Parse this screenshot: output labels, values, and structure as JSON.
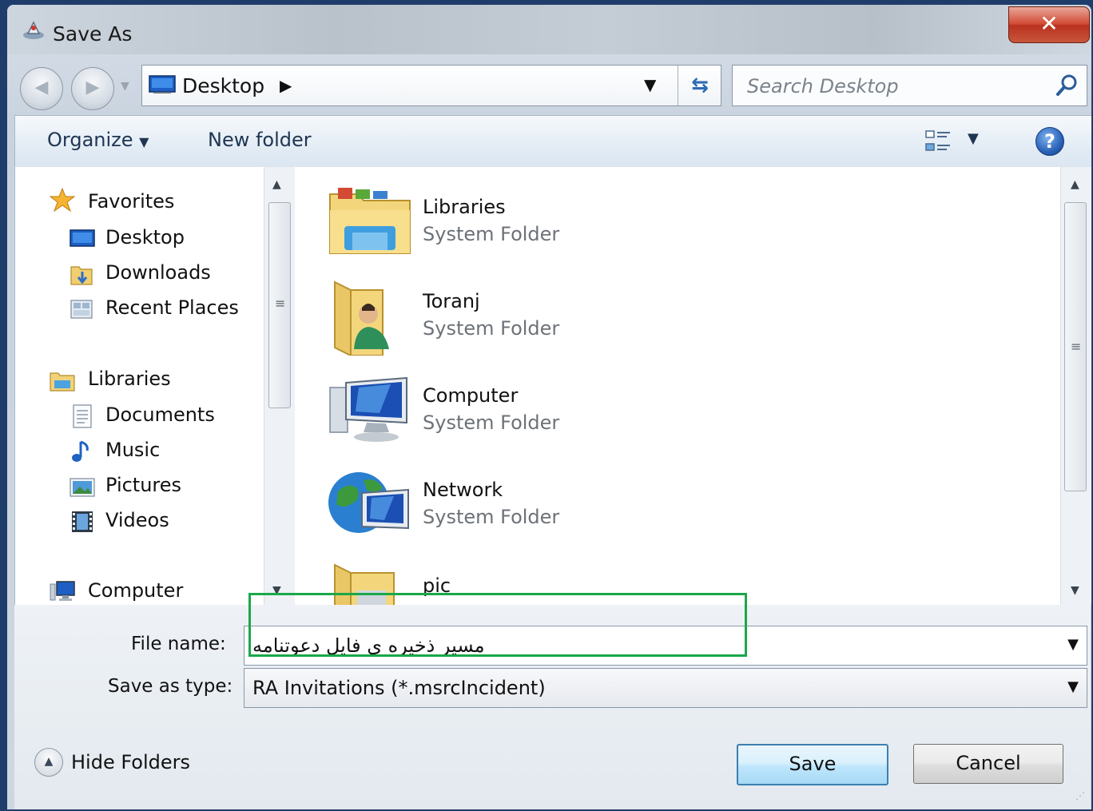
{
  "window": {
    "title": "Save As",
    "close_label": "✕"
  },
  "address_bar": {
    "location": "Desktop"
  },
  "search": {
    "placeholder": "Search Desktop"
  },
  "toolbar": {
    "organize_label": "Organize",
    "new_folder_label": "New folder",
    "help_label": "?"
  },
  "nav": {
    "favorites": {
      "label": "Favorites",
      "items": [
        {
          "label": "Desktop",
          "icon": "desktop-icon"
        },
        {
          "label": "Downloads",
          "icon": "downloads-icon"
        },
        {
          "label": "Recent Places",
          "icon": "recent-places-icon"
        }
      ]
    },
    "libraries": {
      "label": "Libraries",
      "items": [
        {
          "label": "Documents",
          "icon": "documents-icon"
        },
        {
          "label": "Music",
          "icon": "music-icon"
        },
        {
          "label": "Pictures",
          "icon": "pictures-icon"
        },
        {
          "label": "Videos",
          "icon": "videos-icon"
        }
      ]
    },
    "computer": {
      "label": "Computer"
    }
  },
  "files": [
    {
      "name": "Libraries",
      "type": "System Folder",
      "icon": "libraries-folder-icon"
    },
    {
      "name": "Toranj",
      "type": "System Folder",
      "icon": "user-folder-icon"
    },
    {
      "name": "Computer",
      "type": "System Folder",
      "icon": "computer-icon"
    },
    {
      "name": "Network",
      "type": "System Folder",
      "icon": "network-icon"
    },
    {
      "name": "pic",
      "type": "",
      "icon": "folder-icon"
    }
  ],
  "form": {
    "file_name_label": "File name:",
    "file_name_value": "مسیر ذخیره ی فایل دعوتنامه",
    "save_type_label": "Save as type:",
    "save_type_value": "RA Invitations (*.msrcIncident)"
  },
  "footer": {
    "hide_folders_label": "Hide Folders",
    "save_label": "Save",
    "cancel_label": "Cancel"
  },
  "colors": {
    "highlight": "#19a84a",
    "close_button": "#c8452f",
    "save_button_border": "#3c7fb1"
  }
}
